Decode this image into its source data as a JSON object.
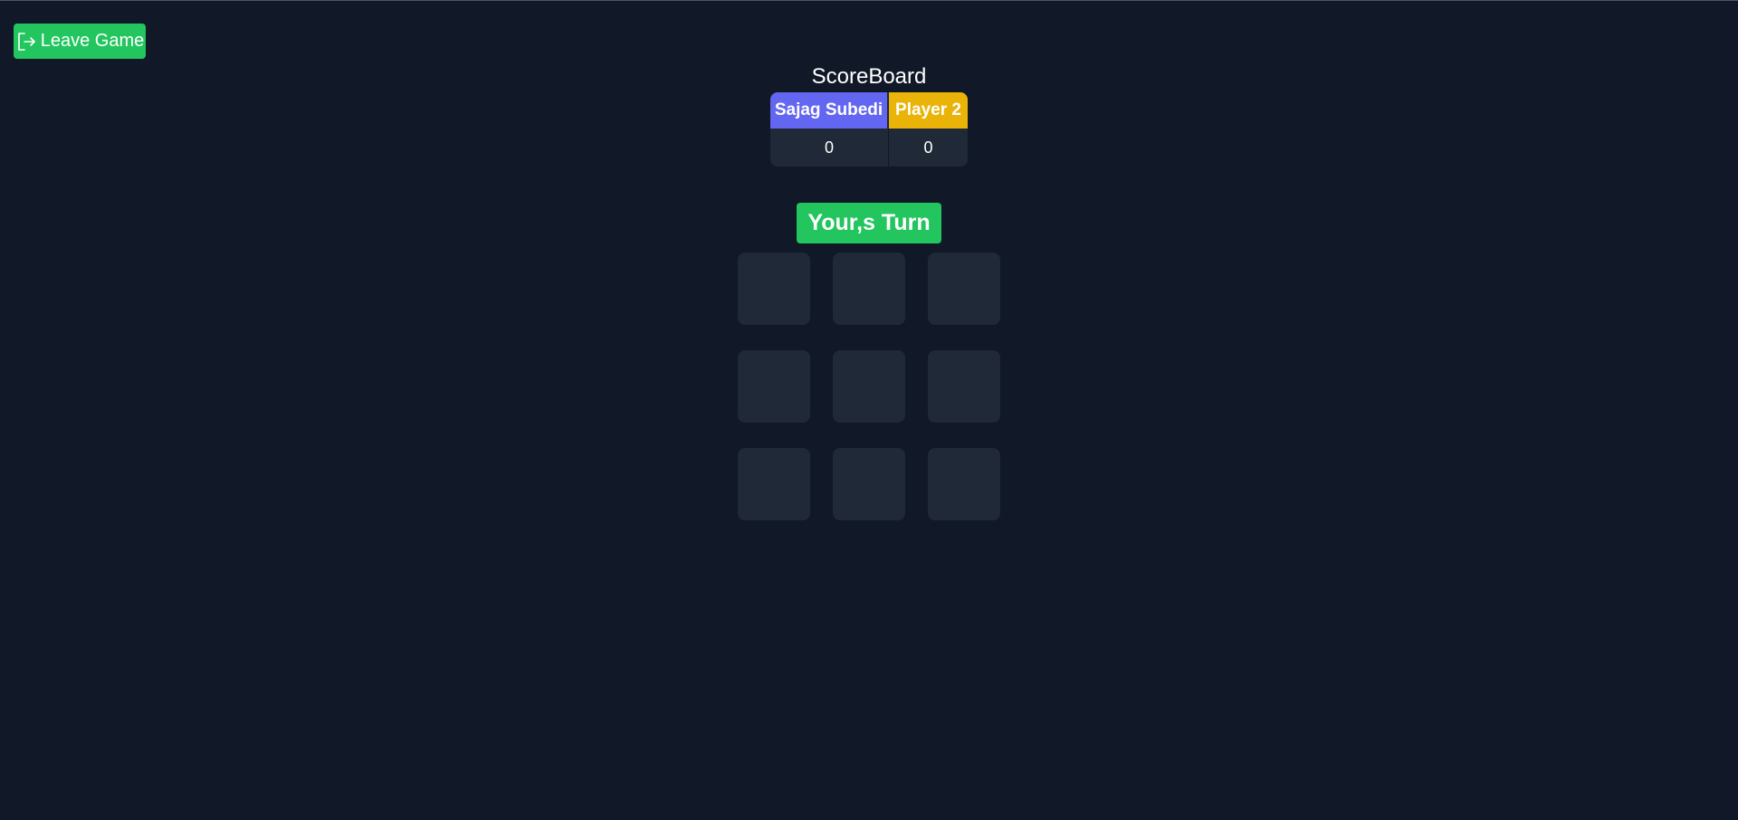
{
  "header": {
    "leave_label": "Leave Game",
    "leave_icon": "exit-icon"
  },
  "scoreboard": {
    "title": "ScoreBoard",
    "players": [
      {
        "name": "Sajag Subedi",
        "score": "0",
        "color": "#6366f1"
      },
      {
        "name": "Player 2",
        "score": "0",
        "color": "#eab308"
      }
    ]
  },
  "status": {
    "turn_label": "Your,s Turn",
    "color": "#22c55e"
  },
  "board": {
    "cells": [
      "",
      "",
      "",
      "",
      "",
      "",
      "",
      "",
      ""
    ]
  },
  "colors": {
    "background": "#111827",
    "cell": "#1f2937",
    "accent": "#22c55e"
  }
}
